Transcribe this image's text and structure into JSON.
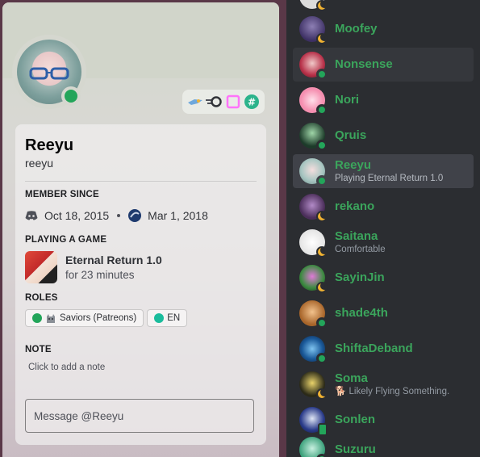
{
  "profile": {
    "display_name": "Reeyu",
    "username": "reeyu",
    "status_color": "#23a55a",
    "member_since": {
      "title": "MEMBER SINCE",
      "discord_date": "Oct 18, 2015",
      "server_date": "Mar 1, 2018"
    },
    "activity": {
      "title": "PLAYING A GAME",
      "game_name": "Eternal Return 1.0",
      "duration": "for 23 minutes"
    },
    "roles": {
      "title": "ROLES",
      "items": [
        {
          "label": "Saviors (Patreons)",
          "color": "#23a55a"
        },
        {
          "label": "EN",
          "color": "#1abc9c"
        }
      ]
    },
    "note": {
      "title": "NOTE",
      "placeholder": "Click to add a note"
    },
    "message": {
      "placeholder": "Message @Reeyu"
    },
    "badges": [
      "hypesquad-icon",
      "speed-icon",
      "nitro-icon",
      "hash-icon"
    ]
  },
  "members": [
    {
      "name": "Moofey",
      "status": "idle",
      "subtext": ""
    },
    {
      "name": "Nonsense",
      "status": "online",
      "subtext": ""
    },
    {
      "name": "Nori",
      "status": "online",
      "subtext": ""
    },
    {
      "name": "Qruis",
      "status": "online",
      "subtext": ""
    },
    {
      "name": "Reeyu",
      "status": "online",
      "subtext": "Playing Eternal Return 1.0"
    },
    {
      "name": "rekano",
      "status": "idle",
      "subtext": ""
    },
    {
      "name": "Saitana",
      "status": "idle",
      "subtext": "Comfortable"
    },
    {
      "name": "SayinJin",
      "status": "idle",
      "subtext": ""
    },
    {
      "name": "shade4th",
      "status": "online",
      "subtext": ""
    },
    {
      "name": "ShiftaDeband",
      "status": "online",
      "subtext": ""
    },
    {
      "name": "Soma",
      "status": "idle",
      "subtext": "Likely Flying Something."
    },
    {
      "name": "Sonlen",
      "status": "mobile",
      "subtext": ""
    },
    {
      "name": "Suzuru",
      "status": "online",
      "subtext": ""
    }
  ],
  "colors": {
    "online": "#23a55a",
    "idle": "#f0b232",
    "name_green": "#3ba55c",
    "sidebar_bg": "#2b2d31"
  }
}
